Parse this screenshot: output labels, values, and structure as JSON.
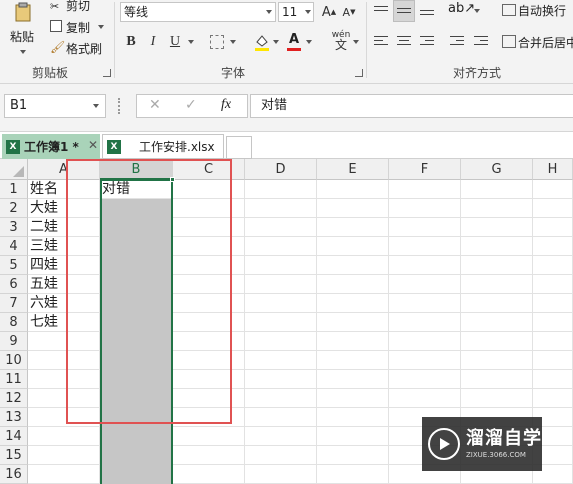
{
  "ribbon": {
    "clipboard": {
      "paste_label": "粘贴",
      "cut_label": "剪切",
      "copy_label": "复制",
      "painter_label": "格式刷",
      "group_label": "剪贴板"
    },
    "font": {
      "font_name": "等线",
      "font_size": "11",
      "bold": "B",
      "italic": "I",
      "underline": "U",
      "phonetic": "wén",
      "group_label": "字体"
    },
    "alignment": {
      "wrap_label": "自动换行",
      "merge_label": "合并后居中",
      "group_label": "对齐方式"
    }
  },
  "formula_bar": {
    "name_box": "B1",
    "fx": "fx",
    "content": "对错"
  },
  "tabs": [
    {
      "label": "工作簿1 *"
    },
    {
      "label": "工作安排.xlsx"
    }
  ],
  "grid": {
    "columns": [
      "A",
      "B",
      "C",
      "D",
      "E",
      "F",
      "G",
      "H"
    ],
    "rows": [
      "1",
      "2",
      "3",
      "4",
      "5",
      "6",
      "7",
      "8",
      "9",
      "10",
      "11",
      "12",
      "13",
      "14",
      "15",
      "16"
    ],
    "col_a_values": [
      "姓名",
      "大娃",
      "二娃",
      "三娃",
      "四娃",
      "五娃",
      "六娃",
      "七娃"
    ],
    "b1_value": "对错"
  },
  "watermark": {
    "main": "溜溜自学",
    "sub": "ZIXUE.3066.COM"
  },
  "colors": {
    "accent": "#217346",
    "highlight_box": "#e05252",
    "selection": "#c6c6c6"
  }
}
